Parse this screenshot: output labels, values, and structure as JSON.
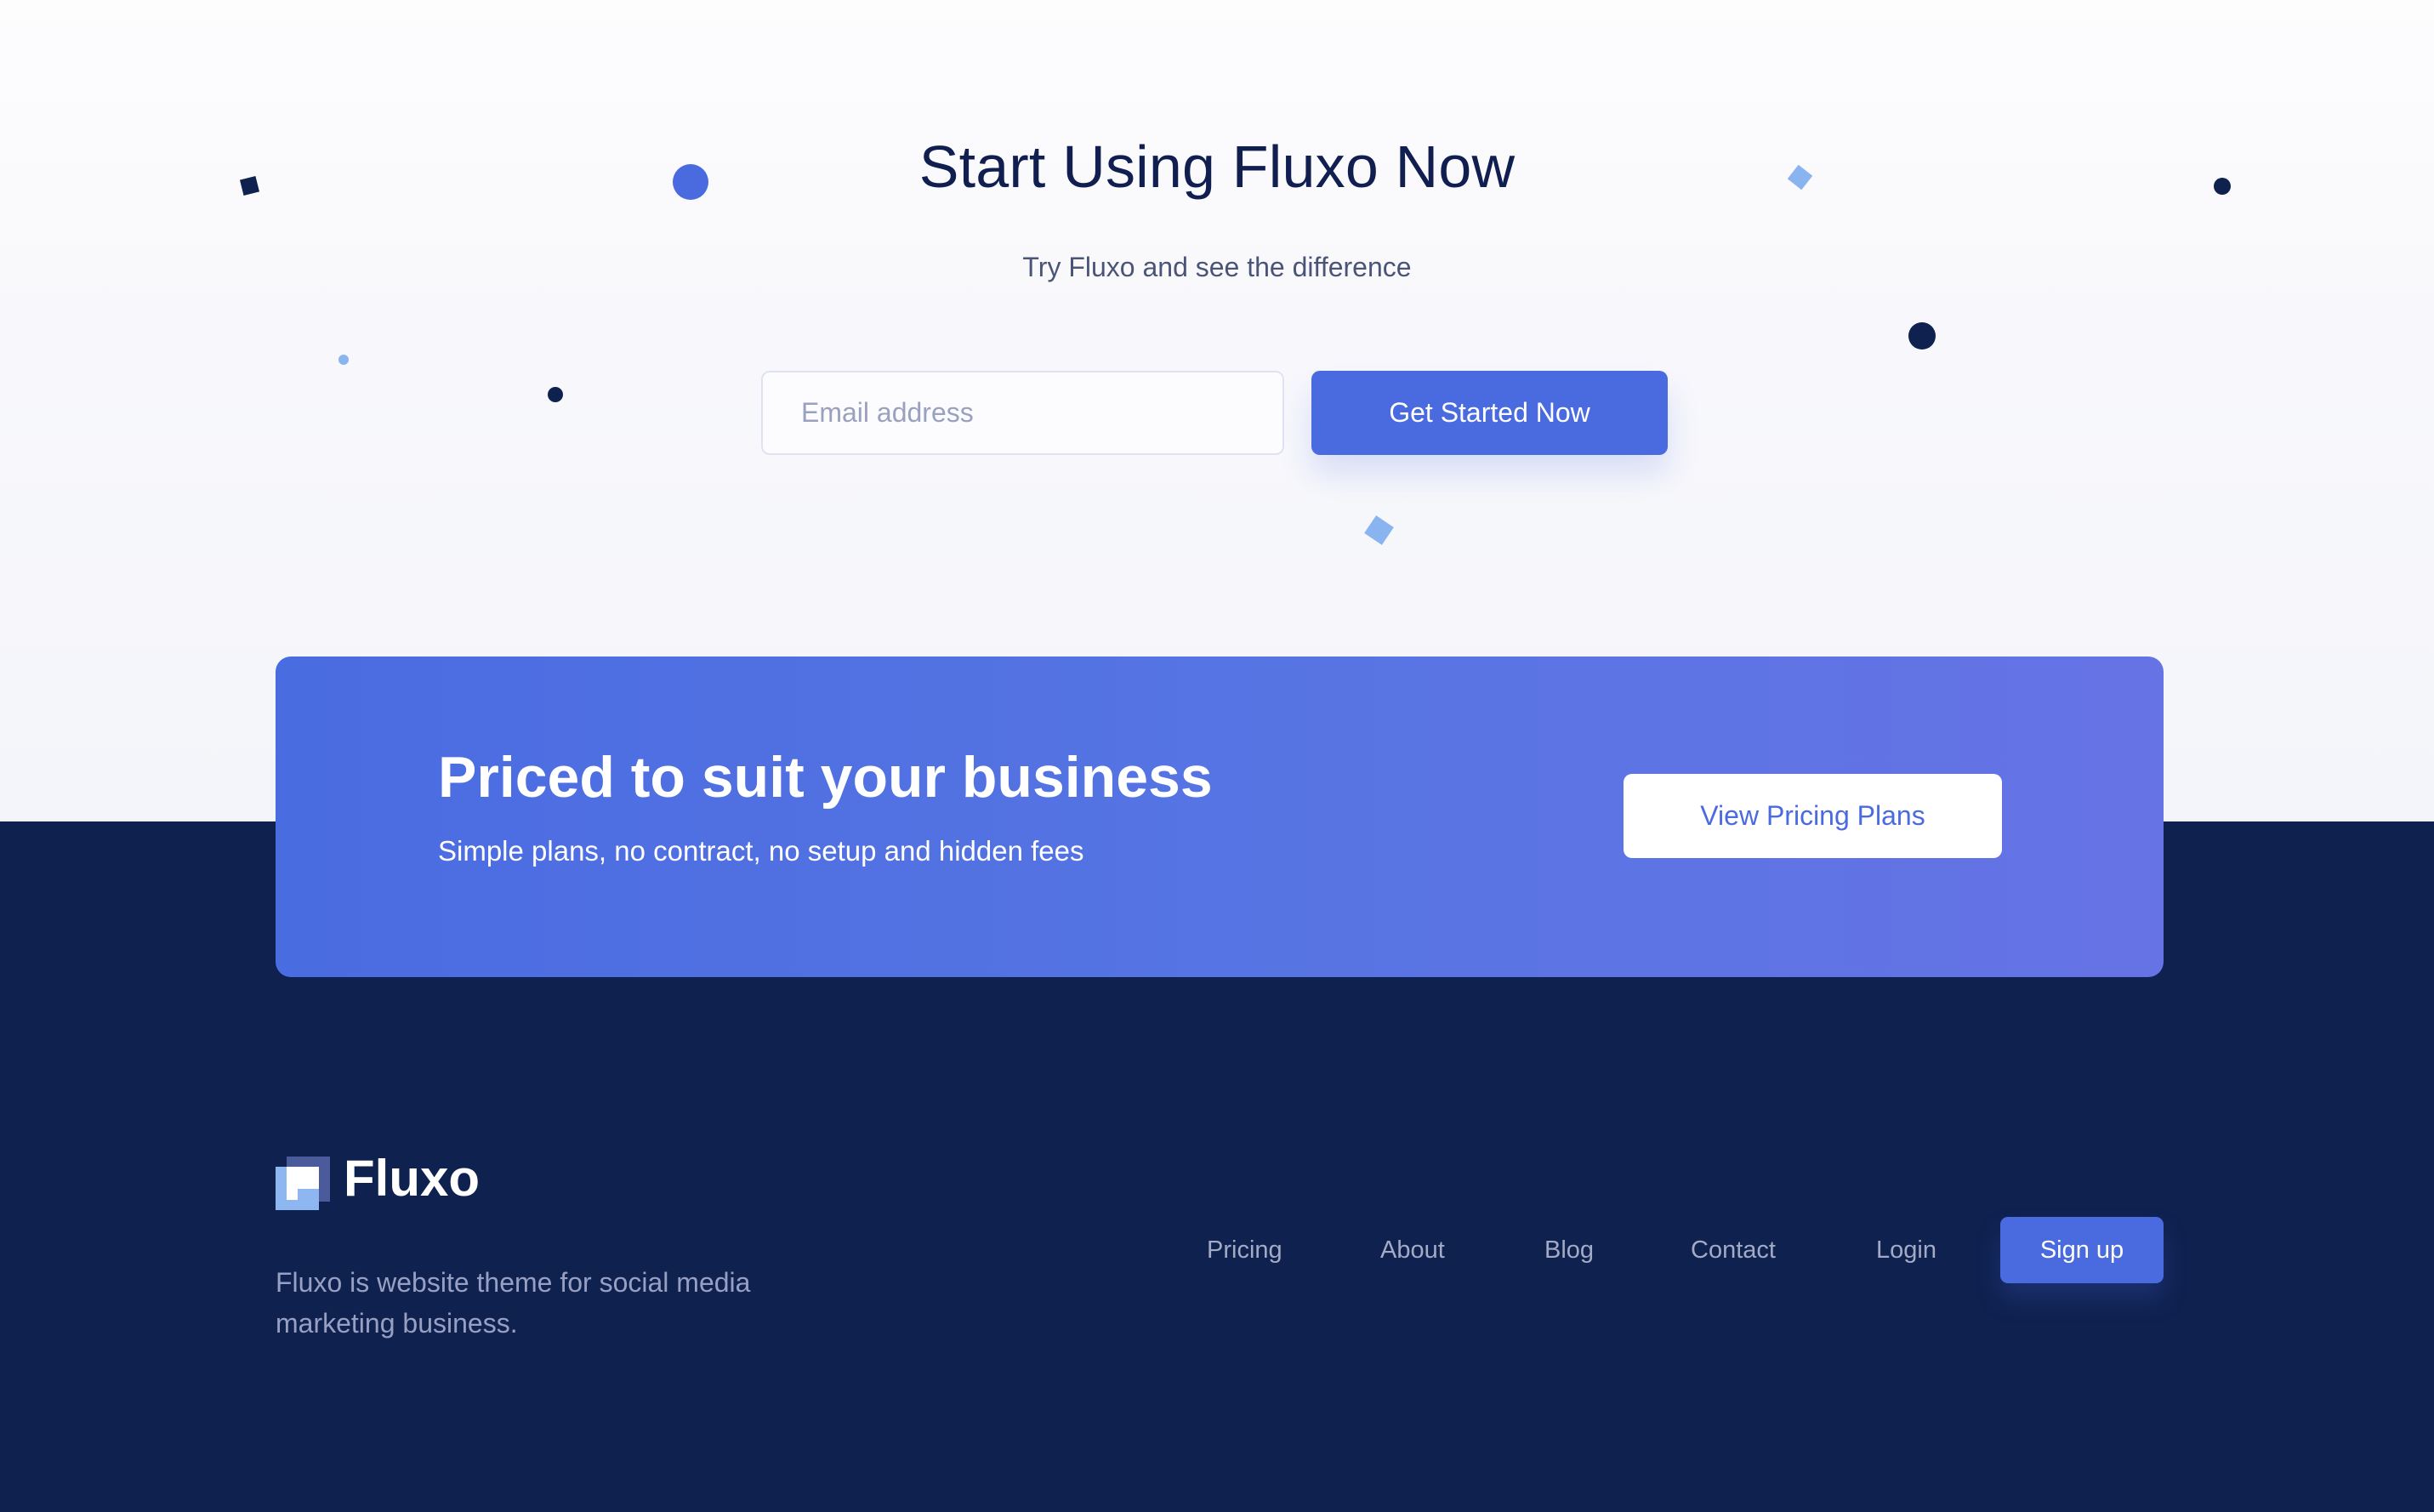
{
  "hero": {
    "title": "Start Using Fluxo Now",
    "subtitle": "Try Fluxo and see the difference",
    "email_placeholder": "Email address",
    "email_value": "",
    "cta_label": "Get Started Now"
  },
  "pricing_banner": {
    "title": "Priced to suit your business",
    "subtitle": "Simple plans, no contract, no setup and hidden fees",
    "button_label": "View Pricing Plans"
  },
  "footer": {
    "brand_name": "Fluxo",
    "logo_icon": "fluxo-logo-icon",
    "description": "Fluxo is website theme for social media marketing business.",
    "nav": [
      {
        "label": "Pricing"
      },
      {
        "label": "About"
      },
      {
        "label": "Blog"
      },
      {
        "label": "Contact"
      },
      {
        "label": "Login"
      }
    ],
    "signup_label": "Sign up"
  },
  "colors": {
    "primary": "#4a6ae0",
    "navy": "#0f214f",
    "heading": "#101f4f",
    "light_blue": "#8ab4f0",
    "banner_gradient_start": "#4a6ce1",
    "banner_gradient_end": "#6673e5"
  }
}
